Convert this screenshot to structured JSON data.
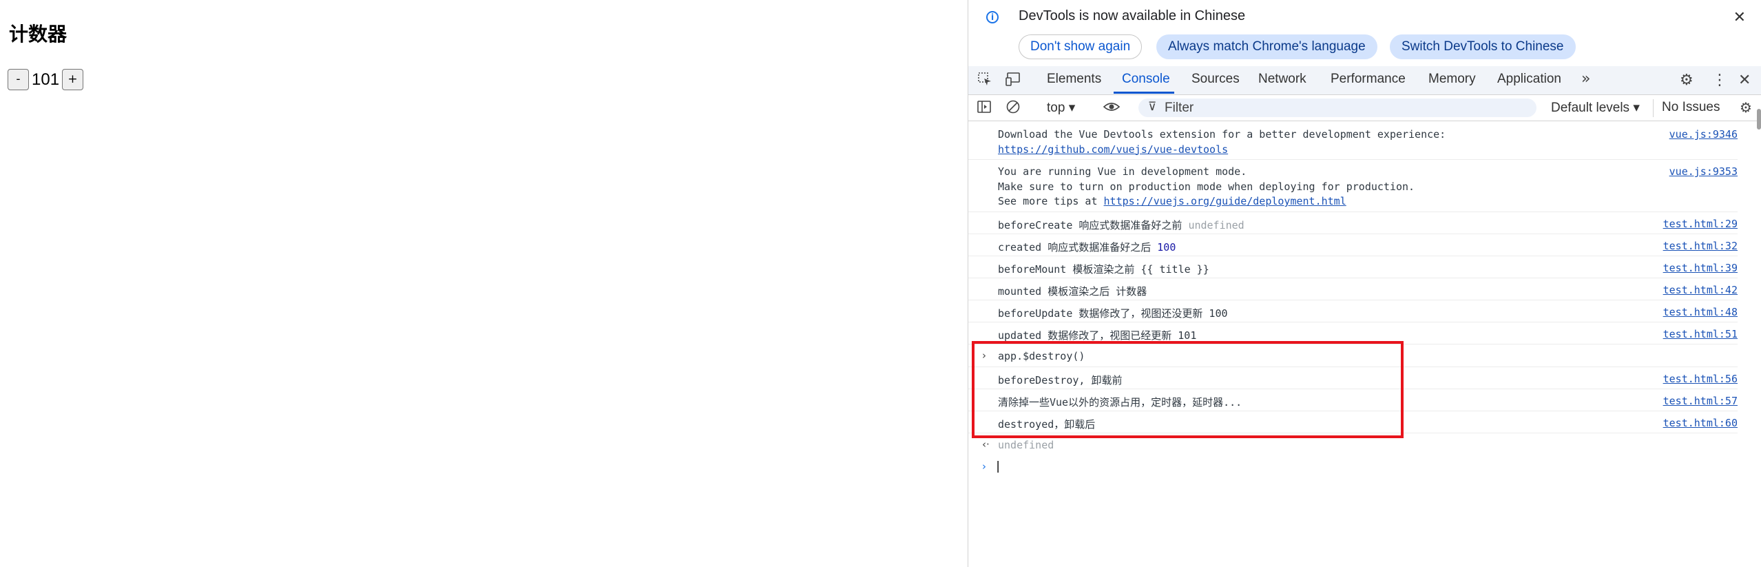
{
  "page": {
    "title": "计数器",
    "minus_label": "-",
    "count": "101",
    "plus_label": "+"
  },
  "infobar": {
    "message": "DevTools is now available in Chinese",
    "dont_show_again": "Don't show again",
    "always_match": "Always match Chrome's language",
    "switch_to_chinese": "Switch DevTools to Chinese",
    "close_glyph": "✕"
  },
  "tabs": [
    "Elements",
    "Console",
    "Sources",
    "Network",
    "Performance",
    "Memory",
    "Application"
  ],
  "active_tab": "Console",
  "toolbar": {
    "context": "top ▾",
    "filter_placeholder": "Filter",
    "levels": "Default levels ▾",
    "issues": "No Issues"
  },
  "console": {
    "vue_devtools_line1": "Download the Vue Devtools extension for a better development experience:",
    "vue_devtools_link": "https://github.com/vuejs/vue-devtools",
    "vue_devtools_src": "vue.js:9346",
    "dev_mode_line1": "You are running Vue in development mode.",
    "dev_mode_line2": "Make sure to turn on production mode when deploying for production.",
    "dev_mode_line3_prefix": "See more tips at ",
    "dev_mode_link": "https://vuejs.org/guide/deployment.html",
    "dev_mode_src": "vue.js:9353",
    "before_create_text": "beforeCreate 响应式数据准备好之前 ",
    "before_create_value": "undefined",
    "before_create_src": "test.html:29",
    "created_text": "created 响应式数据准备好之后 ",
    "created_value": "100",
    "created_src": "test.html:32",
    "before_mount_text": "beforeMount 模板渲染之前 {{ title }}",
    "before_mount_src": "test.html:39",
    "mounted_text": "mounted 模板渲染之后 计数器",
    "mounted_src": "test.html:42",
    "before_update_text": "beforeUpdate 数据修改了，视图还没更新 100",
    "before_update_src": "test.html:48",
    "updated_text": "updated 数据修改了，视图已经更新 101",
    "updated_src": "test.html:51",
    "command": "app.$destroy()",
    "before_destroy_text": "beforeDestroy, 卸载前",
    "before_destroy_src": "test.html:56",
    "cleanup_text": "清除掉一些Vue以外的资源占用，定时器，延时器...",
    "cleanup_src": "test.html:57",
    "destroyed_text": "destroyed，卸载后",
    "destroyed_src": "test.html:60",
    "return_value": "undefined"
  },
  "icons": {
    "info": "info-icon",
    "inspect": "inspect-element-icon",
    "device": "device-toolbar-icon",
    "more_tabs": "chevron-double-right-icon",
    "settings": "gear-icon",
    "menu": "kebab-menu-icon",
    "close": "close-icon",
    "sidebar": "sidebar-toggle-icon",
    "clear": "clear-console-icon",
    "eye": "live-expression-icon",
    "filter": "filter-icon",
    "console_settings": "gear-icon"
  },
  "colors": {
    "accent": "#0b57d0",
    "highlight_border": "#e8141c",
    "link": "#1a52b6",
    "number": "#1a1aa6"
  }
}
